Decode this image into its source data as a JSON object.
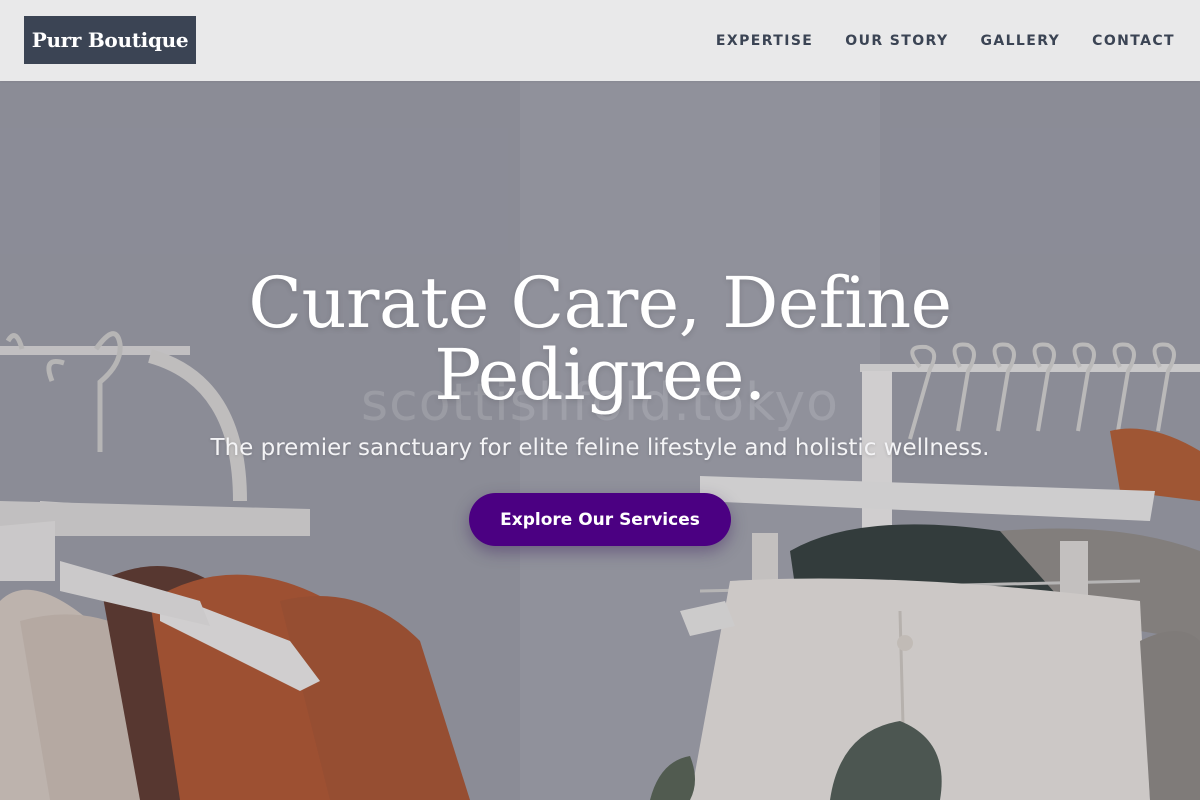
{
  "brand": {
    "name": "Purr Boutique"
  },
  "nav": {
    "items": [
      {
        "label": "EXPERTISE"
      },
      {
        "label": "OUR STORY"
      },
      {
        "label": "GALLERY"
      },
      {
        "label": "CONTACT"
      }
    ]
  },
  "hero": {
    "title": "Curate Care, Define Pedigree.",
    "subtitle": "The premier sanctuary for elite feline lifestyle and holistic wellness.",
    "cta_label": "Explore Our Services",
    "watermark": "scottishfold.tokyo"
  },
  "colors": {
    "logo_bg": "#3b4454",
    "nav_text": "#3b4454",
    "header_bg": "#e9e9ea",
    "cta_bg": "#4b0082"
  }
}
